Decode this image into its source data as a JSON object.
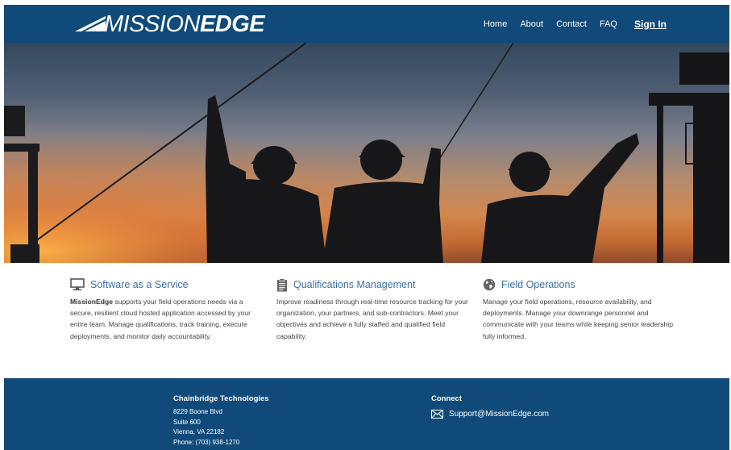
{
  "header": {
    "logo_part1": "MISSION",
    "logo_part2": "EDGE",
    "nav": [
      {
        "label": "Home"
      },
      {
        "label": "About"
      },
      {
        "label": "Contact"
      },
      {
        "label": "FAQ"
      },
      {
        "label": "Sign In"
      }
    ]
  },
  "hero": {
    "image_description": "silhouettes of three workers in hard hats at sunset near oil rigs",
    "icons": []
  },
  "features": [
    {
      "icon": "monitor-icon",
      "title": "Software as a Service",
      "body_bold": "MissionEdge",
      "body": " supports your field operations needs via a secure, resilient cloud hosted application accessed by your entire team. Manage qualifications, track training, execute deployments, and monitor daily accountability."
    },
    {
      "icon": "clipboard-icon",
      "title": "Qualifications Management",
      "body_bold": "",
      "body": "Improve readiness through real-time resource tracking for your organization, your partners, and sub-contractors. Meet your objectives and achieve a fully staffed and qualified field capability."
    },
    {
      "icon": "globe-icon",
      "title": "Field Operations",
      "body_bold": "",
      "body": "Manage your field operations, resource availability, and deployments. Manage your downrange personnel and communicate with your teams while keeping senior leadership fully informed."
    }
  ],
  "footer": {
    "company_name": "Chainbridge Technologies",
    "address_lines": [
      "8229 Boone Blvd",
      "Suite 600",
      "Vienna, VA 22182",
      "Phone: (703) 938-1270"
    ],
    "connect_title": "Connect",
    "email": "Support@MissionEdge.com"
  },
  "colors": {
    "primary": "#0f4a7a",
    "feature_title": "#3a6ea5"
  }
}
